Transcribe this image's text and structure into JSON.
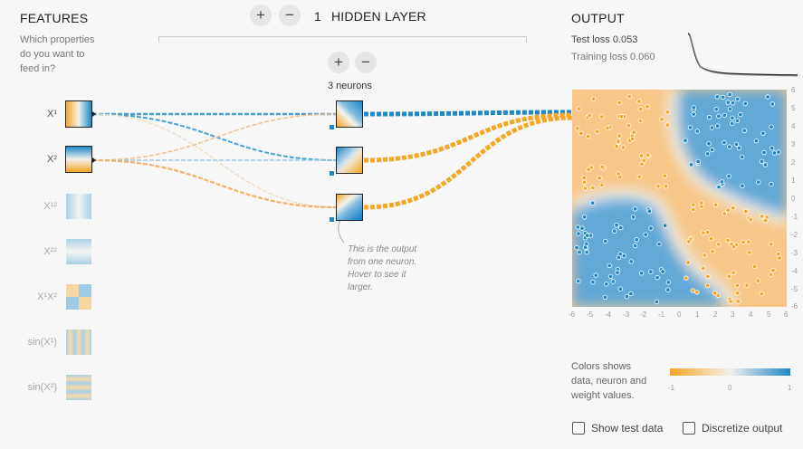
{
  "features": {
    "title": "FEATURES",
    "subtitle_lines": [
      "Which properties",
      "do you want to",
      "feed in?"
    ],
    "items": [
      {
        "label": "X¹",
        "active": true
      },
      {
        "label": "X²",
        "active": true
      },
      {
        "label": "X¹²",
        "active": false
      },
      {
        "label": "X²²",
        "active": false
      },
      {
        "label": "X¹X²",
        "active": false
      },
      {
        "label": "sin(X¹)",
        "active": false
      },
      {
        "label": "sin(X²)",
        "active": false
      }
    ]
  },
  "layers": {
    "add_glyph": "+",
    "remove_glyph": "−",
    "count": "1",
    "title": "HIDDEN LAYER",
    "neuron_add": "+",
    "neuron_remove": "−",
    "neurons_label": "3 neurons"
  },
  "annotation_lines": [
    "This is the output",
    "from one neuron.",
    "Hover to see it",
    "larger."
  ],
  "output": {
    "title": "OUTPUT",
    "test_loss": "Test loss 0.053",
    "training_loss": "Training loss 0.060",
    "x_ticks": [
      "-6",
      "-5",
      "-4",
      "-3",
      "-2",
      "-1",
      "0",
      "1",
      "2",
      "3",
      "4",
      "5",
      "6"
    ],
    "y_ticks": [
      "6",
      "5",
      "4",
      "3",
      "2",
      "1",
      "0",
      "-1",
      "-2",
      "-3",
      "-4",
      "-5",
      "-6"
    ]
  },
  "legend": {
    "lines": [
      "Colors shows",
      "data, neuron and",
      "weight values."
    ],
    "min": "-1",
    "mid": "0",
    "max": "1",
    "color_negative": "#f5a623",
    "color_positive": "#1e88c8"
  },
  "controls": {
    "show_test_data": "Show test data",
    "discretize_output": "Discretize output"
  }
}
